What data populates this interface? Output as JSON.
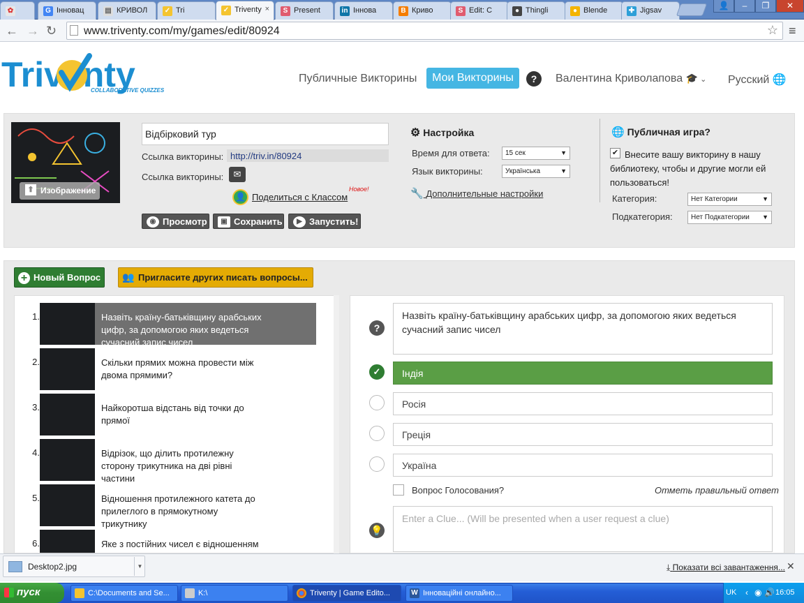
{
  "browser": {
    "tabs": [
      {
        "label": "",
        "fav": "#e7e7e7",
        "icon": "apps-icon"
      },
      {
        "label": "Інновац",
        "fav": "#4285f4",
        "icon": "google-icon"
      },
      {
        "label": "КРИВОЛ",
        "fav": "#dddddd",
        "icon": "page-icon"
      },
      {
        "label": "Tri",
        "fav": "#f4c430",
        "icon": "triventy-icon"
      },
      {
        "label": "Triventy",
        "fav": "#f4c430",
        "icon": "triventy-icon"
      },
      {
        "label": "Present",
        "fav": "#e05c6f",
        "icon": "s-icon"
      },
      {
        "label": "Іннова",
        "fav": "#0e76a8",
        "icon": "linkedin-icon"
      },
      {
        "label": "Криво",
        "fav": "#f57d00",
        "icon": "blogger-icon"
      },
      {
        "label": "Edit: C",
        "fav": "#e05c6f",
        "icon": "s-icon"
      },
      {
        "label": "Thingli",
        "fav": "#444444",
        "icon": "thinglink-icon"
      },
      {
        "label": "Blende",
        "fav": "#f4b400",
        "icon": "blendspace-icon"
      },
      {
        "label": "Jigsav",
        "fav": "#2c9fd8",
        "icon": "jigsaw-icon"
      }
    ],
    "address": "www.triventy.com/my/games/edit/80924"
  },
  "header": {
    "logo_text": "Triventy",
    "logo_tagline": "COLLABORATIVE QUIZZES",
    "nav_public": "Публичные Викторины",
    "nav_mine": "Мои Викторины",
    "help": "?",
    "user": "Валентина Криволапова",
    "language": "Русский"
  },
  "settings": {
    "image_button": "Изображение",
    "title_value": "Відбірковий тур",
    "link_label": "Ссылка викторины:",
    "link_value": "http://triv.in/80924",
    "link_label2": "Ссылка викторины:",
    "share": "Поделиться с Классом",
    "new_badge": "Новое!",
    "btn_preview": "Просмотр",
    "btn_save": "Сохранить",
    "btn_launch": "Запустить!",
    "setup_title": "Настройка",
    "answer_time_label": "Время для ответа:",
    "answer_time_value": "15 сек",
    "quiz_lang_label": "Язык викторины:",
    "quiz_lang_value": "Українська",
    "advanced": "Дополнительные настройки",
    "public_title": "Публичная игра?",
    "public_text": "Внесите вашу викторину в нашу библиотеку, чтобы и другие могли ей пользоваться!",
    "category_label": "Категория:",
    "category_value": "Нет Категории",
    "subcategory_label": "Подкатегория:",
    "subcategory_value": "Нет Подкатегории"
  },
  "questions": {
    "new_button": "Новый Вопрос",
    "invite_button": "Пригласите других писать вопросы...",
    "list": [
      {
        "num": "1.",
        "text": "Назвіть країну-батьківщину арабських цифр, за допомогою яких ведеться сучасний запис чисел"
      },
      {
        "num": "2.",
        "text": "Скільки прямих можна провести між двома прямими?"
      },
      {
        "num": "3.",
        "text": "Найкоротша відстань від точки до прямої"
      },
      {
        "num": "4.",
        "text": "Відрізок, що ділить протилежну сторону трикутника на дві рівні частини"
      },
      {
        "num": "5.",
        "text": "Відношення протилежного катета до прилеглого в прямокутному трикутнику"
      },
      {
        "num": "6.",
        "text": "Яке з постійних чисел є відношенням"
      }
    ]
  },
  "editor": {
    "question": "Назвіть країну-батьківщину арабських цифр, за допомогою яких ведеться сучасний запис чисел",
    "answers": [
      "Індія",
      "Росія",
      "Греція",
      "Україна"
    ],
    "vote_label": "Вопрос Голосования?",
    "mark_correct": "Отметь правильный ответ",
    "clue_placeholder": "Enter a Clue... (Will be presented when a user request a clue)"
  },
  "downloads": {
    "file": "Desktop2.jpg",
    "show_all": "Показати всі завантаження..."
  },
  "taskbar": {
    "start": "пуск",
    "items": [
      "C:\\Documents and Se...",
      "K:\\",
      "Triventy | Game Edito...",
      "Інноваційні онлайно..."
    ],
    "lang": "UK",
    "clock": "16:05"
  },
  "colors": {
    "accent": "#45b6e3",
    "green": "#2f7d32",
    "correct": "#5a9e45",
    "invite": "#e4ab04"
  }
}
